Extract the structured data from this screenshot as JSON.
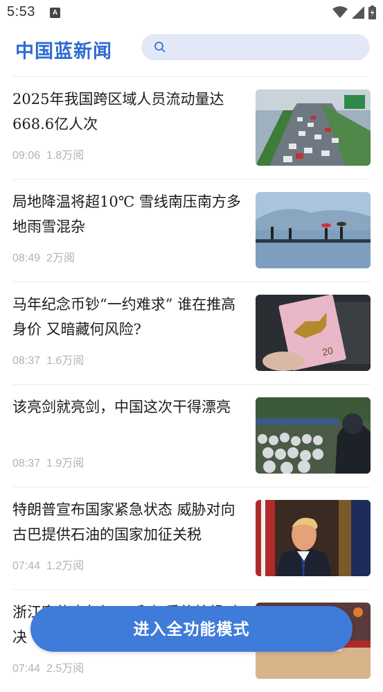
{
  "status_bar": {
    "time": "5:53",
    "notification_icon_letter": "A",
    "icons": [
      "wifi-icon",
      "signal-icon",
      "battery-charging-icon"
    ]
  },
  "header": {
    "logo": "中国蓝新闻",
    "search_placeholder": "",
    "search_icon": "search-icon"
  },
  "news": [
    {
      "title": "2025年我国跨区域人员流动量达668.6亿人次",
      "time": "09:06",
      "views": "1.8万阅",
      "thumb": "highway-traffic"
    },
    {
      "title": "局地降温将超10℃ 雪线南压南方多地雨雪混杂",
      "time": "08:49",
      "views": "2万阅",
      "thumb": "lake-walkers-umbrellas"
    },
    {
      "title": "马年纪念币钞“一约难求” 谁在推高身价 又暗藏何风险?",
      "time": "08:37",
      "views": "1.6万阅",
      "thumb": "horse-banknote"
    },
    {
      "title": "该亮剑就亮剑，中国这次干得漂亮",
      "time": "08:37",
      "views": "1.9万阅",
      "thumb": "police-crowd"
    },
    {
      "title": "特朗普宣布国家紧急状态 威胁对向古巴提供石油的国家加征关税",
      "time": "07:44",
      "views": "1.2万阅",
      "thumb": "politician-portrait"
    },
    {
      "title": "浙江宣传大年初一“和加重的棉组对决",
      "time": "07:44",
      "views": "2.5万阅",
      "thumb": "basketball-game"
    }
  ],
  "cta": {
    "label": "进入全功能模式"
  },
  "colors": {
    "brand": "#2f6bd3",
    "button": "#3f7bd9",
    "search_bg": "#e3e8f8",
    "meta": "#b2b2b2"
  }
}
